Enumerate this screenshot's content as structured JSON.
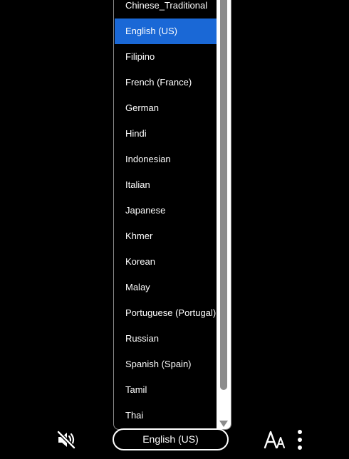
{
  "language_menu": {
    "options": [
      "Chinese_Traditional",
      "English (US)",
      "Filipino",
      "French (France)",
      "German",
      "Hindi",
      "Indonesian",
      "Italian",
      "Japanese",
      "Khmer",
      "Korean",
      "Malay",
      "Portuguese (Portugal)",
      "Russian",
      "Spanish (Spain)",
      "Tamil",
      "Thai"
    ],
    "selected": "English (US)"
  },
  "controls": {
    "mute_icon": "speaker-muted-icon",
    "language_select_value": "English (US)",
    "font_size_icon": "font-size-icon",
    "more_icon": "more-vertical-icon"
  },
  "colors": {
    "background": "#000000",
    "selected_highlight": "#1a68d6",
    "text": "#ffffff",
    "scrollbar_thumb": "#8c8c8c"
  }
}
